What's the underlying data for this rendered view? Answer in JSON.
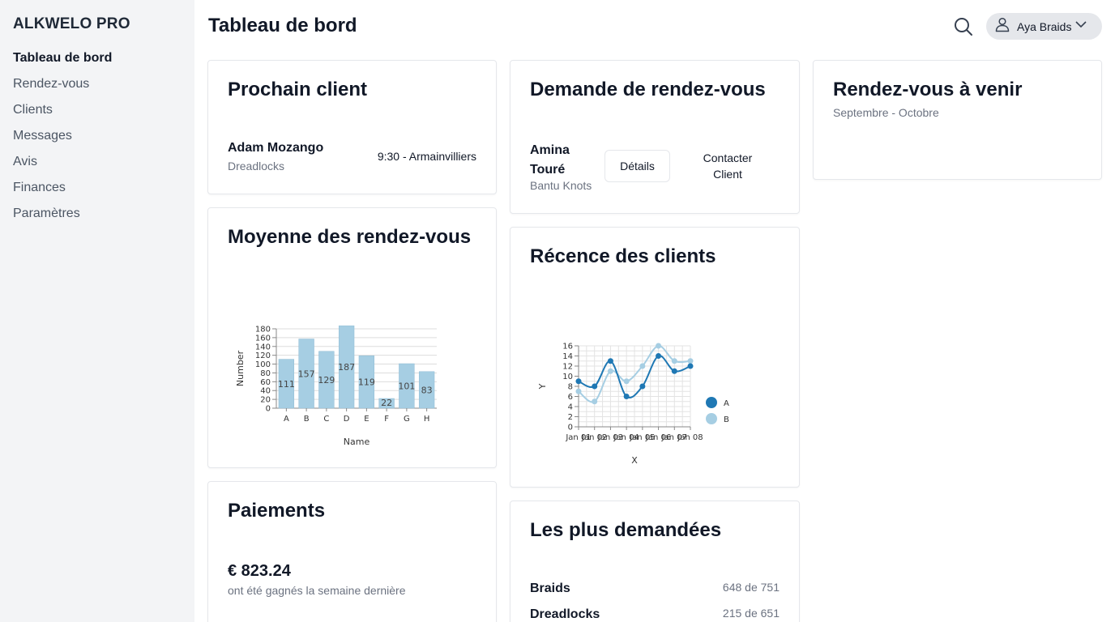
{
  "app": {
    "brand": "ALKWELO PRO"
  },
  "sidebar": {
    "items": [
      {
        "label": "Tableau de bord",
        "active": true
      },
      {
        "label": "Rendez-vous"
      },
      {
        "label": "Clients"
      },
      {
        "label": "Messages"
      },
      {
        "label": "Avis"
      },
      {
        "label": "Finances"
      },
      {
        "label": "Paramètres"
      }
    ]
  },
  "header": {
    "title": "Tableau de bord",
    "search_icon": "search-icon",
    "user": {
      "name": "Aya Braids",
      "icon": "user-icon"
    }
  },
  "next_client": {
    "title": "Prochain client",
    "name": "Adam Mozango",
    "service": "Dreadlocks",
    "time": "9:30 - Armainvilliers"
  },
  "request": {
    "title": "Demande de rendez-vous",
    "name_line1": "Amina",
    "name_line2": "Touré",
    "service": "Bantu Knots",
    "details_label": "Détails",
    "contact_line1": "Contacter",
    "contact_line2": "Client"
  },
  "upcoming": {
    "title": "Rendez-vous à venir",
    "period": "Septembre - Octobre"
  },
  "avg_appointments": {
    "title": "Moyenne des rendez-vous"
  },
  "recency": {
    "title": "Récence des clients"
  },
  "payments": {
    "title": "Paiements",
    "amount": "€ 823.24",
    "caption": "ont été gagnés la semaine dernière"
  },
  "most_requested": {
    "title": "Les plus demandées",
    "items": [
      {
        "name": "Braids",
        "count": "648 de 751"
      },
      {
        "name": "Dreadlocks",
        "count": "215 de 651"
      }
    ]
  },
  "chart_data": [
    {
      "type": "bar",
      "categories": [
        "A",
        "B",
        "C",
        "D",
        "E",
        "F",
        "G",
        "H"
      ],
      "values": [
        111,
        157,
        129,
        187,
        119,
        22,
        101,
        83
      ],
      "xlabel": "Name",
      "ylabel": "Number",
      "ylim": [
        0,
        180
      ],
      "yticks": [
        0,
        20,
        40,
        60,
        80,
        100,
        120,
        140,
        160,
        180
      ],
      "grid": true,
      "color": "#a6cee3"
    },
    {
      "type": "line",
      "x": [
        "Jan 01",
        "Jan 02",
        "Jan 03",
        "Jan 04",
        "Jan 05",
        "Jan 06",
        "Jan 07",
        "Jan 08"
      ],
      "x_tick_labels": [
        "Jan 01",
        "Jan 02",
        "Jan 03",
        "Jan 04",
        "Jan 05",
        "Jan 06",
        "Jan 07",
        "Jan 08"
      ],
      "series": [
        {
          "name": "A",
          "values": [
            9,
            8,
            13,
            6,
            8,
            14,
            11,
            12
          ],
          "color": "#1f78b4"
        },
        {
          "name": "B",
          "values": [
            7,
            5,
            11,
            9,
            12,
            16,
            13,
            13
          ],
          "color": "#a6cee3"
        }
      ],
      "xlabel": "X",
      "ylabel": "Y",
      "ylim": [
        0,
        16
      ],
      "yticks": [
        0,
        2,
        4,
        6,
        8,
        10,
        12,
        14,
        16
      ],
      "grid": true,
      "legend": "right"
    }
  ]
}
